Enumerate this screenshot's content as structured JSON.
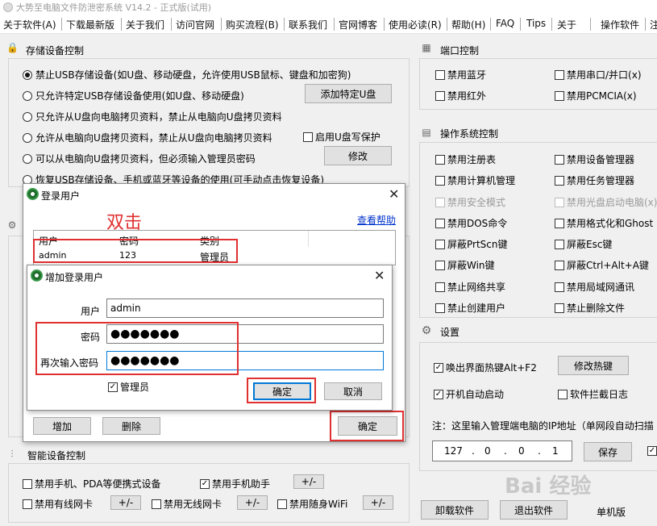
{
  "title": "大势至电脑文件防泄密系统 V14.2 - 正式版(试用)",
  "menu": [
    "关于软件(A)",
    "下载最新版",
    "关于我们",
    "访问官网",
    "购买流程(B)",
    "联系我们",
    "官网博客",
    "使用必读(R)",
    "帮助(H)",
    "FAQ",
    "Tips",
    "关于",
    "操作软件",
    "注"
  ],
  "storage": {
    "title": "存储设备控制",
    "options": [
      "禁止USB存储设备(如U盘、移动硬盘，允许使用USB鼠标、键盘和加密狗)",
      "只允许特定USB存储设备使用(如U盘、移动硬盘)",
      "只允许从U盘向电脑拷贝资料，禁止从电脑向U盘拷贝资料",
      "允许从电脑向U盘拷贝资料，禁止从U盘向电脑拷贝资料",
      "可以从电脑向U盘拷贝资料，但必须输入管理员密码",
      "恢复USB存储设备、手机或蓝牙等设备的使用(可手动点击恢复设备)"
    ],
    "add_udisk": "添加特定U盘",
    "write_protect": "启用U盘写保护",
    "modify": "修改"
  },
  "port": {
    "title": "端口控制",
    "items": [
      "禁用蓝牙",
      "禁用串口/并口(x)",
      "禁用红外",
      "禁用PCMCIA(x)"
    ]
  },
  "os": {
    "title": "操作系统控制",
    "items": [
      "禁用注册表",
      "禁用设备管理器",
      "禁用计算机管理",
      "禁用任务管理器",
      "禁用安全模式",
      "禁用光盘启动电脑(x)",
      "禁用DOS命令",
      "禁用格式化和Ghost",
      "屏蔽PrtScn键",
      "屏蔽Esc键",
      "屏蔽Win键",
      "屏蔽Ctrl+Alt+A键",
      "禁止网络共享",
      "禁用局域网通讯",
      "禁止创建用户",
      "禁止删除文件"
    ]
  },
  "settings": {
    "title": "设置",
    "hotkey": "唤出界面热键Alt+F2",
    "modify_hotkey": "修改热键",
    "autostart": "开机自动启动",
    "intercept_log": "软件拦截日志",
    "note": "注：这里输入管理端电脑的IP地址（单网段自动扫描",
    "ip": [
      "127",
      "0",
      "0",
      "1"
    ],
    "save": "保存"
  },
  "smart": {
    "title": "智能设备控制",
    "items": [
      "禁用手机、PDA等便携式设备",
      "禁用手机助手",
      "禁用有线网卡",
      "禁用无线网卡",
      "禁用随身WiFi"
    ],
    "pm": "+/-"
  },
  "bottom": {
    "uninstall": "卸载软件",
    "exit": "退出软件",
    "edition": "单机版"
  },
  "login_dialog": {
    "title": "登录用户",
    "help": "查看帮助",
    "headers": [
      "用户",
      "密码",
      "类别"
    ],
    "row": [
      "admin",
      "123",
      "管理员"
    ],
    "add": "增加",
    "delete": "删除",
    "ok": "确定",
    "annotation": "双击"
  },
  "add_dialog": {
    "title": "增加登录用户",
    "user_label": "用户",
    "user_value": "admin",
    "pwd_label": "密码",
    "pwd_value": "●●●●●●●",
    "pwd2_label": "再次输入密码",
    "pwd2_value": "●●●●●●●",
    "admin_label": "管理员",
    "ok": "确定",
    "cancel": "取消"
  },
  "watermark": "Bai 经验",
  "colors": {
    "annotation_red": "#e03030",
    "focus_blue": "#0078d7",
    "link_blue": "#0033cc"
  }
}
